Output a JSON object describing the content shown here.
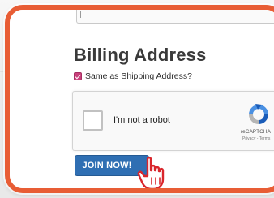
{
  "billing": {
    "title": "Billing Address",
    "same_as_shipping_label": "Same as Shipping Address?",
    "same_as_shipping_checked": true
  },
  "captcha": {
    "checkbox_label": "I'm not a robot",
    "brand": "reCAPTCHA",
    "privacy_terms": "Privacy - Terms"
  },
  "join": {
    "label": "JOIN NOW!"
  },
  "colors": {
    "highlight_border": "#e85d35",
    "checkbox_accent": "#c9407b",
    "button_blue": "#2f6fb3"
  },
  "icons": {
    "cursor": "hand-pointer-icon",
    "recaptcha": "recaptcha-logo-icon"
  }
}
